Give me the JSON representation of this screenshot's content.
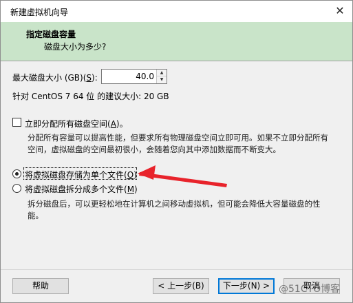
{
  "window": {
    "title": "新建虚拟机向导",
    "close_glyph": "✕"
  },
  "header": {
    "title": "指定磁盘容量",
    "subtitle": "磁盘大小为多少?"
  },
  "disk_size": {
    "label_prefix": "最大磁盘大小 (GB)(",
    "label_key": "S",
    "label_suffix": "):",
    "value": "40.0",
    "recommended": "针对 CentOS 7 64 位 的建议大小: 20 GB"
  },
  "allocate": {
    "label_prefix": "立即分配所有磁盘空间(",
    "label_key": "A",
    "label_suffix": ")。",
    "checked": false,
    "desc_line1": "分配所有容量可以提高性能，但要求所有物理磁盘空间立即可用。如果不立即分配所有",
    "desc_line2": "空间，虚拟磁盘的空间最初很小，会随着您向其中添加数据而不断变大。"
  },
  "single_file": {
    "label_prefix": "将虚拟磁盘存储为单个文件(",
    "label_key": "O",
    "label_suffix": ")",
    "selected": true
  },
  "multi_file": {
    "label_prefix": "将虚拟磁盘拆分成多个文件(",
    "label_key": "M",
    "label_suffix": ")",
    "selected": false,
    "desc_line1": "拆分磁盘后，可以更轻松地在计算机之间移动虚拟机，但可能会降低大容量磁盘的性",
    "desc_line2": "能。"
  },
  "buttons": {
    "help": "帮助",
    "back": "< 上一步(B)",
    "next": "下一步(N) >",
    "cancel": "取消"
  },
  "watermark": "@51CTO博客",
  "colors": {
    "header_bg": "#c9e4c9",
    "arrow": "#e8232b",
    "focus_border": "#0078d7"
  }
}
